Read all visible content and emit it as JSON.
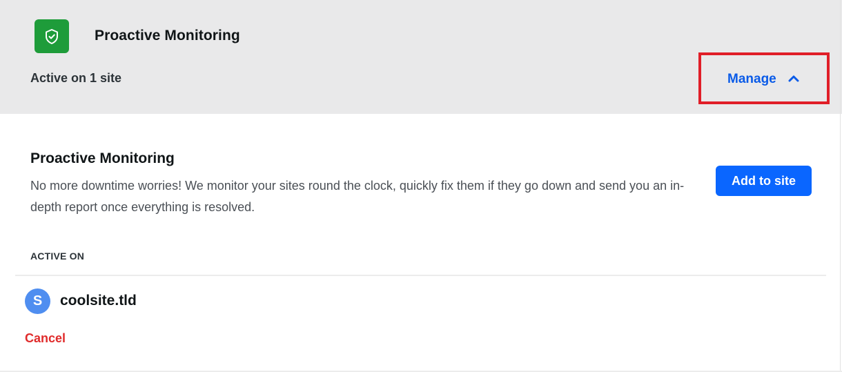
{
  "header": {
    "title": "Proactive Monitoring",
    "active_status": "Active on 1 site",
    "logo_icon": "shield-check-icon",
    "logo_color": "#1e9c3a",
    "manage_label": "Manage",
    "manage_icon": "chevron-up-icon",
    "highlight_color": "#e01e28"
  },
  "detail": {
    "title": "Proactive Monitoring",
    "description": "No more downtime worries! We monitor your sites round the clock, quickly fix them if they go down and send you an in-depth report once everything is resolved.",
    "add_button_label": "Add to site",
    "accent_color": "#0a66ff"
  },
  "active_on": {
    "heading": "ACTIVE ON",
    "sites": [
      {
        "avatar_letter": "S",
        "name": "coolsite.tld"
      }
    ],
    "cancel_label": "Cancel",
    "cancel_color": "#e02b2b"
  }
}
